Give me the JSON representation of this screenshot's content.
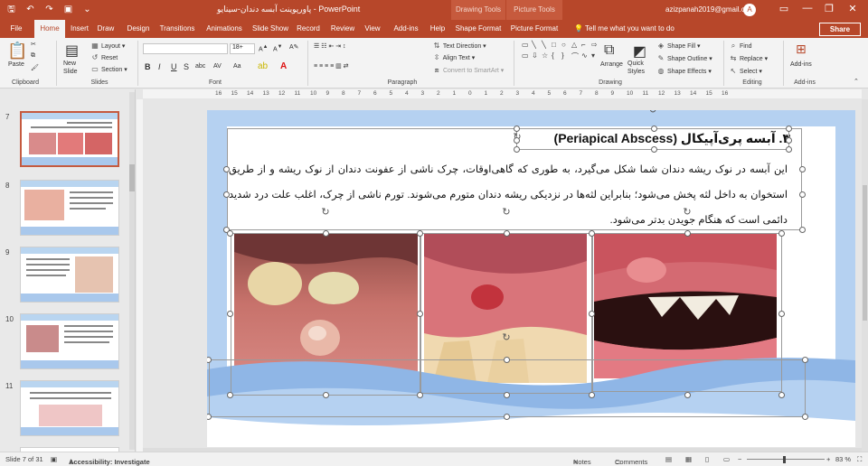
{
  "window": {
    "title": "پاورپوینت آبسه دندان-سینایو  -  PowerPoint",
    "context_tab_drawing": "Drawing Tools",
    "context_tab_picture": "Picture Tools",
    "user_email": "azizpanah2019@gmail.com",
    "user_initial": "A",
    "minimize": "—",
    "restore": "❐",
    "close": "✕"
  },
  "tabs": [
    {
      "label": "File"
    },
    {
      "label": "Home"
    },
    {
      "label": "Insert"
    },
    {
      "label": "Draw"
    },
    {
      "label": "Design"
    },
    {
      "label": "Transitions"
    },
    {
      "label": "Animations"
    },
    {
      "label": "Slide Show"
    },
    {
      "label": "Record"
    },
    {
      "label": "Review"
    },
    {
      "label": "View"
    },
    {
      "label": "Add-ins"
    },
    {
      "label": "Help"
    },
    {
      "label": "Shape Format"
    },
    {
      "label": "Picture Format"
    }
  ],
  "tell_me": "Tell me what you want to do",
  "share_label": "Share",
  "ribbon": {
    "clipboard": {
      "label": "Clipboard",
      "paste": "Paste"
    },
    "slides": {
      "label": "Slides",
      "new_slide": "New Slide",
      "layout": "Layout",
      "reset": "Reset",
      "section": "Section"
    },
    "font": {
      "label": "Font",
      "size": "18+",
      "bold": "B",
      "italic": "I",
      "underline": "U",
      "strike": "S",
      "shadow": "abc",
      "spacing": "AV",
      "case": "Aa"
    },
    "paragraph": {
      "label": "Paragraph",
      "text_direction": "Text Direction",
      "align_text": "Align Text",
      "convert_smartart": "Convert to SmartArt"
    },
    "drawing": {
      "label": "Drawing",
      "arrange": "Arrange",
      "quick_styles": "Quick Styles",
      "shape_fill": "Shape Fill",
      "shape_outline": "Shape Outline",
      "shape_effects": "Shape Effects"
    },
    "editing": {
      "label": "Editing",
      "find": "Find",
      "replace": "Replace",
      "select": "Select"
    },
    "addins": {
      "label": "Add-ins",
      "addins_btn": "Add-ins"
    }
  },
  "thumbnails": [
    {
      "num": "7",
      "selected": true
    },
    {
      "num": "8",
      "selected": false
    },
    {
      "num": "9",
      "selected": false
    },
    {
      "num": "10",
      "selected": false
    },
    {
      "num": "11",
      "selected": false
    }
  ],
  "ruler_ticks": [
    "16",
    "15",
    "14",
    "13",
    "12",
    "11",
    "10",
    "9",
    "8",
    "7",
    "6",
    "5",
    "4",
    "3",
    "2",
    "1",
    "0",
    "1",
    "2",
    "3",
    "4",
    "5",
    "6",
    "7",
    "8",
    "9",
    "10",
    "11",
    "12",
    "13",
    "14",
    "15",
    "16"
  ],
  "slide": {
    "heading": "۳. آبسه پری‌آپیکال (Periapical Abscess)",
    "body": "این آبسه در نوک ریشه دندان شما شکل می‌گیرد، به طوری که گاهی‌اوقات، چرک ناشی از عفونت دندان از نوک ریشه و از طریق استخوان به داخل لثه پخش می‌شود؛ بنابراین لثه‌ها در نزدیکی ریشه دندان متورم می‌شوند. تورم ناشی از چرک، اغلب علت درد شدید دائمی است که هنگام جویدن بدتر می‌شود."
  },
  "status": {
    "slide_info": "Slide 7 of 31",
    "accessibility": "Accessibility: Investigate",
    "notes": "Notes",
    "comments": "Comments",
    "zoom": "83 %"
  },
  "colors": {
    "accent": "#b7472a",
    "slide_blue": "#b5d1f1",
    "wave_blue": "#8fb6e6"
  }
}
